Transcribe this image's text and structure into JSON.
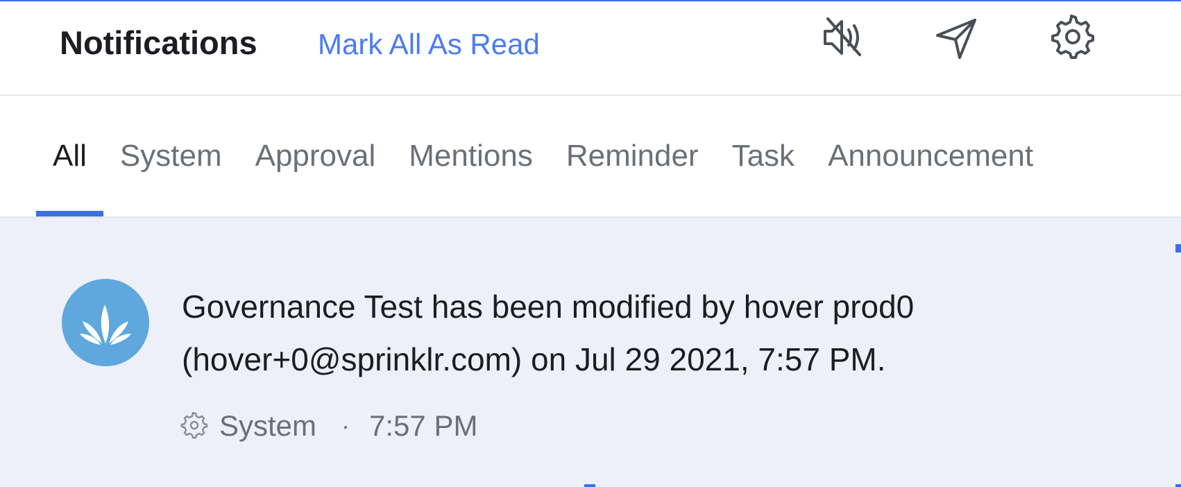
{
  "header": {
    "title": "Notifications",
    "mark_all_label": "Mark All As Read"
  },
  "icons": {
    "mute": "speaker-mute-icon",
    "send": "send-icon",
    "settings": "gear-icon"
  },
  "tabs": [
    {
      "label": "All",
      "active": true
    },
    {
      "label": "System",
      "active": false
    },
    {
      "label": "Approval",
      "active": false
    },
    {
      "label": "Mentions",
      "active": false
    },
    {
      "label": "Reminder",
      "active": false
    },
    {
      "label": "Task",
      "active": false
    },
    {
      "label": "Announcement",
      "active": false
    }
  ],
  "notifications": [
    {
      "message": "Governance Test has been modified by hover prod0 (hover+0@sprinklr.com) on Jul 29 2021, 7:57 PM.",
      "category": "System",
      "separator": "·",
      "time": "7:57 PM",
      "avatar_icon": "sprinklr-logo-icon"
    }
  ],
  "colors": {
    "accent": "#3a6fe8",
    "link": "#4a7cf0",
    "unread_bg": "#edf0f8",
    "avatar_bg": "#5fa7dc"
  }
}
